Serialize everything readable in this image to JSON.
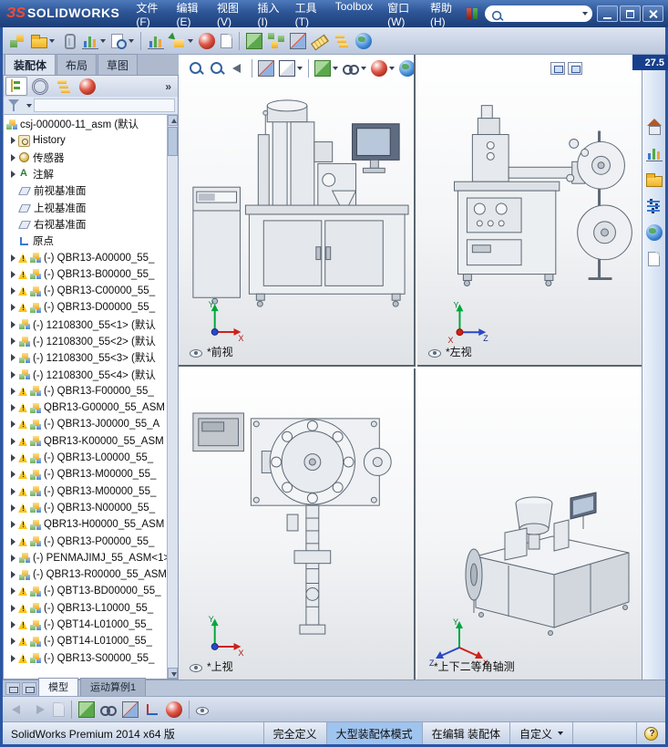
{
  "titlebar": {
    "logo_mark": "ЗS",
    "logo_text": "SOLIDWORKS",
    "search": {
      "value": "",
      "placeholder": ""
    },
    "win_buttons": [
      {
        "name": "minimize-button",
        "glyph": "min"
      },
      {
        "name": "maximize-button",
        "glyph": "max"
      },
      {
        "name": "close-button",
        "glyph": "close"
      }
    ]
  },
  "menu": {
    "items": [
      {
        "id": "file",
        "label": "文件(F)"
      },
      {
        "id": "edit",
        "label": "编辑(E)"
      },
      {
        "id": "view",
        "label": "视图(V)"
      },
      {
        "id": "insert",
        "label": "插入(I)"
      },
      {
        "id": "tools",
        "label": "工具(T)"
      },
      {
        "id": "toolbox",
        "label": "Toolbox"
      },
      {
        "id": "window",
        "label": "窗口(W)"
      },
      {
        "id": "help",
        "label": "帮助(H)"
      }
    ]
  },
  "toolbar": {
    "icons": [
      {
        "name": "edit-component-icon",
        "kind": "cubes"
      },
      {
        "name": "open-icon",
        "kind": "folder",
        "dd": true
      },
      {
        "name": "mate-icon",
        "kind": "clip"
      },
      {
        "name": "evaluate-icon",
        "kind": "chart",
        "dd": true
      },
      {
        "name": "print-preview-icon",
        "kind": "zoomdoc",
        "dd": true
      },
      {
        "sep": true
      },
      {
        "name": "assembly-statistics-icon",
        "kind": "chart"
      },
      {
        "name": "insert-component-icon",
        "kind": "boxarrow",
        "dd": true
      },
      {
        "name": "edit-appearance-icon",
        "kind": "ball"
      },
      {
        "name": "new-document-icon",
        "kind": "page"
      },
      {
        "sep": true
      },
      {
        "name": "simulation-icon",
        "kind": "cube"
      },
      {
        "name": "exploded-view-icon",
        "kind": "explode"
      },
      {
        "name": "interference-detection-icon",
        "kind": "section"
      },
      {
        "name": "measure-icon",
        "kind": "measure"
      },
      {
        "name": "bill-of-materials-icon",
        "kind": "config"
      },
      {
        "name": "smart-fasteners-icon",
        "kind": "globe"
      }
    ]
  },
  "command_tabs": {
    "tabs": [
      {
        "id": "assembly",
        "label": "装配体",
        "active": true
      },
      {
        "id": "layout",
        "label": "布局",
        "active": false
      },
      {
        "id": "sketch",
        "label": "草图",
        "active": false
      }
    ]
  },
  "feature_panel": {
    "manager_tabs": [
      {
        "name": "featuremanager-design-tree-icon",
        "kind": "tree",
        "active": true
      },
      {
        "name": "propertymanager-icon",
        "kind": "gear",
        "active": false
      },
      {
        "name": "configurationmanager-icon",
        "kind": "config",
        "active": false
      },
      {
        "name": "displaymanager-icon",
        "kind": "ball",
        "active": false
      }
    ],
    "overflow_label": "»",
    "filter": {
      "icon": "filter-funnel-icon",
      "value": "",
      "placeholder": ""
    },
    "tree": [
      {
        "label": "csj-000000-11_asm (默认",
        "icon": "assembly",
        "indent": 0,
        "arrow": false,
        "warning": false
      },
      {
        "label": "History",
        "icon": "history",
        "indent": 1,
        "arrow": true,
        "warning": false
      },
      {
        "label": "传感器",
        "icon": "sensors",
        "indent": 1,
        "arrow": true,
        "warning": false
      },
      {
        "label": "注解",
        "icon": "annotations",
        "indent": 1,
        "arrow": true,
        "warning": false
      },
      {
        "label": "前视基准面",
        "icon": "plane",
        "indent": 1,
        "arrow": false,
        "warning": false
      },
      {
        "label": "上视基准面",
        "icon": "plane",
        "indent": 1,
        "arrow": false,
        "warning": false
      },
      {
        "label": "右视基准面",
        "icon": "plane",
        "indent": 1,
        "arrow": false,
        "warning": false
      },
      {
        "label": "原点",
        "icon": "origin",
        "indent": 1,
        "arrow": false,
        "warning": false
      },
      {
        "label": "(-) QBR13-A00000_55_",
        "icon": "assembly",
        "indent": 1,
        "arrow": true,
        "warning": true
      },
      {
        "label": "(-) QBR13-B00000_55_",
        "icon": "assembly",
        "indent": 1,
        "arrow": true,
        "warning": true
      },
      {
        "label": "(-) QBR13-C00000_55_",
        "icon": "assembly",
        "indent": 1,
        "arrow": true,
        "warning": true
      },
      {
        "label": "(-) QBR13-D00000_55_",
        "icon": "assembly",
        "indent": 1,
        "arrow": true,
        "warning": true
      },
      {
        "label": "(-) 12108300_55<1> (默认",
        "icon": "assembly",
        "indent": 1,
        "arrow": true,
        "warning": false
      },
      {
        "label": "(-) 12108300_55<2> (默认",
        "icon": "assembly",
        "indent": 1,
        "arrow": true,
        "warning": false
      },
      {
        "label": "(-) 12108300_55<3> (默认",
        "icon": "assembly",
        "indent": 1,
        "arrow": true,
        "warning": false
      },
      {
        "label": "(-) 12108300_55<4> (默认",
        "icon": "assembly",
        "indent": 1,
        "arrow": true,
        "warning": false
      },
      {
        "label": "(-) QBR13-F00000_55_",
        "icon": "assembly",
        "indent": 1,
        "arrow": true,
        "warning": true
      },
      {
        "label": "QBR13-G00000_55_ASM",
        "icon": "assembly",
        "indent": 1,
        "arrow": true,
        "warning": true
      },
      {
        "label": "(-) QBR13-J00000_55_A",
        "icon": "assembly",
        "indent": 1,
        "arrow": true,
        "warning": true
      },
      {
        "label": "QBR13-K00000_55_ASM",
        "icon": "assembly",
        "indent": 1,
        "arrow": true,
        "warning": true
      },
      {
        "label": "(-) QBR13-L00000_55_",
        "icon": "assembly",
        "indent": 1,
        "arrow": true,
        "warning": true
      },
      {
        "label": "(-) QBR13-M00000_55_",
        "icon": "assembly",
        "indent": 1,
        "arrow": true,
        "warning": true
      },
      {
        "label": "(-) QBR13-M00000_55_",
        "icon": "assembly",
        "indent": 1,
        "arrow": true,
        "warning": true
      },
      {
        "label": "(-) QBR13-N00000_55_",
        "icon": "assembly",
        "indent": 1,
        "arrow": true,
        "warning": true
      },
      {
        "label": "QBR13-H00000_55_ASM",
        "icon": "assembly",
        "indent": 1,
        "arrow": true,
        "warning": true
      },
      {
        "label": "(-) QBR13-P00000_55_",
        "icon": "assembly",
        "indent": 1,
        "arrow": true,
        "warning": true
      },
      {
        "label": "(-) PENMAJIMJ_55_ASM<1>",
        "icon": "assembly",
        "indent": 1,
        "arrow": true,
        "warning": false
      },
      {
        "label": "(-) QBR13-R00000_55_ASM",
        "icon": "assembly",
        "indent": 1,
        "arrow": true,
        "warning": false
      },
      {
        "label": "(-) QBT13-BD00000_55_",
        "icon": "assembly",
        "indent": 1,
        "arrow": true,
        "warning": true
      },
      {
        "label": "(-) QBR13-L10000_55_",
        "icon": "assembly",
        "indent": 1,
        "arrow": true,
        "warning": true
      },
      {
        "label": "(-) QBT14-L01000_55_",
        "icon": "assembly",
        "indent": 1,
        "arrow": true,
        "warning": true
      },
      {
        "label": "(-) QBT14-L01000_55_",
        "icon": "assembly",
        "indent": 1,
        "arrow": true,
        "warning": true
      },
      {
        "label": "(-) QBR13-S00000_55_",
        "icon": "assembly",
        "indent": 1,
        "arrow": true,
        "warning": true
      }
    ]
  },
  "graphics": {
    "value_overlay": "27.5",
    "headsup_icons": [
      {
        "name": "zoom-fit-icon",
        "kind": "magnifier"
      },
      {
        "name": "zoom-area-icon",
        "kind": "magnifier"
      },
      {
        "name": "previous-view-icon",
        "kind": "prev"
      },
      {
        "sep": true
      },
      {
        "name": "section-view-icon",
        "kind": "section"
      },
      {
        "name": "view-orientation-icon",
        "kind": "cubeoutline",
        "dd": true
      },
      {
        "sep": true
      },
      {
        "name": "display-style-icon",
        "kind": "cube",
        "dd": true
      },
      {
        "name": "hide-show-items-icon",
        "kind": "glasses",
        "dd": true
      },
      {
        "name": "edit-appearance-icon",
        "kind": "ball",
        "dd": true
      },
      {
        "name": "apply-scene-icon",
        "kind": "globe",
        "dd": true
      },
      {
        "name": "view-settings-icon",
        "kind": "eye",
        "dd": true
      }
    ],
    "viewport_buttons": [
      {
        "name": "viewport-link-button"
      },
      {
        "name": "viewport-maximize-button"
      }
    ],
    "viewports": [
      {
        "id": "front",
        "label": "*前视",
        "axes": {
          "up": "Y",
          "right": "X"
        }
      },
      {
        "id": "left",
        "label": "*左视",
        "axes": {
          "up": "Y",
          "right": "Z",
          "out": "X"
        }
      },
      {
        "id": "top",
        "label": "*上视",
        "axes": {
          "up": "Y",
          "right": "X"
        }
      },
      {
        "id": "iso",
        "label": "*上下二等角轴测",
        "axes": {
          "up": "Y",
          "right": "X",
          "left": "Z"
        }
      }
    ]
  },
  "task_pane": {
    "icons": [
      {
        "name": "home-icon",
        "kind": "home"
      },
      {
        "name": "solidworks-resources-icon",
        "kind": "chart"
      },
      {
        "name": "design-library-icon",
        "kind": "folder"
      },
      {
        "name": "file-explorer-icon",
        "kind": "sliders"
      },
      {
        "name": "appearances-scenes-icon",
        "kind": "globe"
      },
      {
        "name": "custom-properties-icon",
        "kind": "page"
      }
    ]
  },
  "bottom_tabs": {
    "buttons": [
      {
        "name": "splitter-button"
      },
      {
        "name": "tab-list-button"
      }
    ],
    "tabs": [
      {
        "id": "model",
        "label": "模型",
        "active": true
      },
      {
        "id": "motion-study-1",
        "label": "运动算例1",
        "active": false
      }
    ]
  },
  "bottom_toolbar": {
    "icons": [
      {
        "name": "previous-frame-icon",
        "kind": "prev",
        "disabled": true
      },
      {
        "name": "next-frame-icon",
        "kind": "next",
        "disabled": true
      },
      {
        "name": "notes-icon",
        "kind": "page",
        "disabled": true
      },
      {
        "sep": true
      },
      {
        "name": "isolate-icon",
        "kind": "cube"
      },
      {
        "name": "hide-show-components-icon",
        "kind": "glasses"
      },
      {
        "name": "section-icon",
        "kind": "section"
      },
      {
        "name": "reference-axes-icon",
        "kind": "axes"
      },
      {
        "name": "appearance-icon",
        "kind": "ball"
      },
      {
        "sep": true
      },
      {
        "name": "camera-view-icon",
        "kind": "eye"
      }
    ]
  },
  "statusbar": {
    "left": "SolidWorks Premium 2014 x64 版",
    "segments": [
      {
        "label": "完全定义",
        "active": false,
        "dropdown": false
      },
      {
        "label": "大型装配体模式",
        "active": true,
        "dropdown": false
      },
      {
        "label": "在编辑 装配体",
        "active": false,
        "dropdown": false
      },
      {
        "label": "自定义",
        "active": false,
        "dropdown": true
      }
    ],
    "help_icon": "help-icon"
  }
}
